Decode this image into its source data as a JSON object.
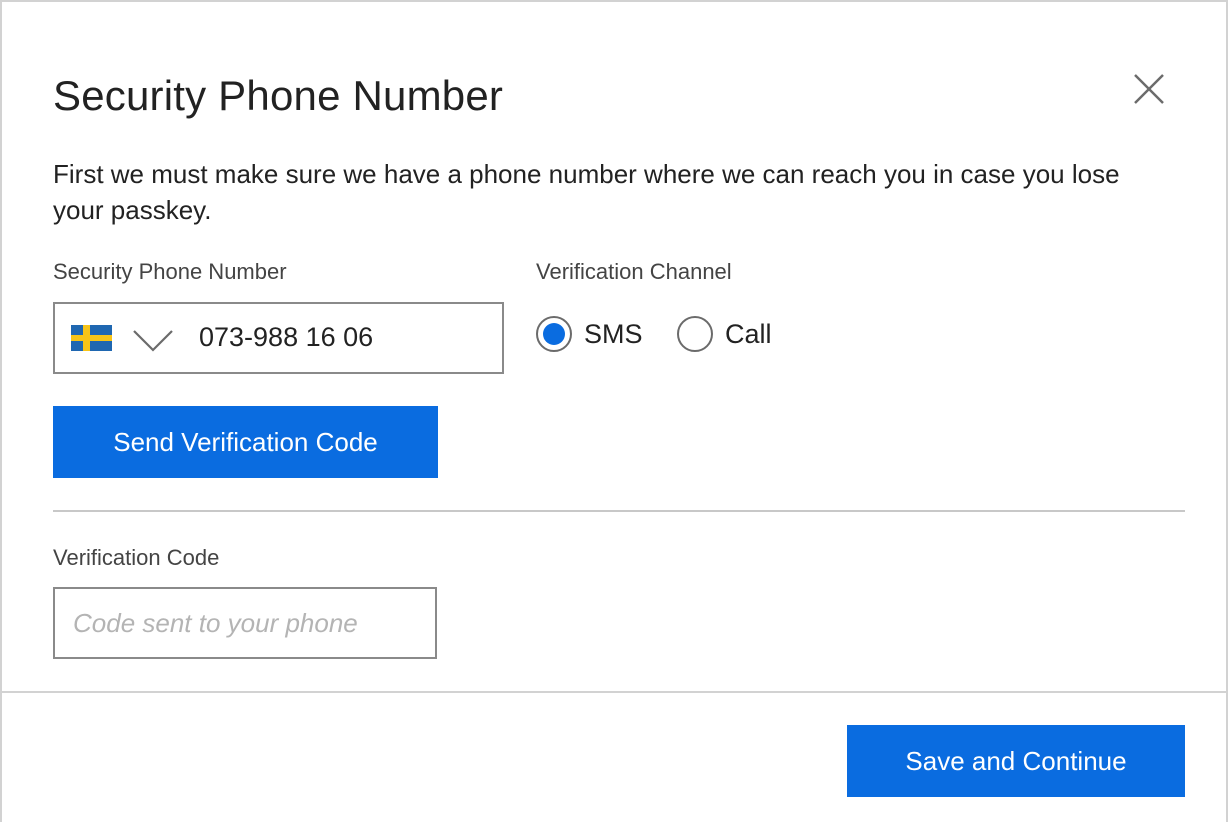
{
  "dialog": {
    "title": "Security Phone Number",
    "description": "First we must make sure we have a phone number where we can reach you in case you lose your passkey.",
    "close_icon": "close-icon"
  },
  "phone": {
    "label": "Security Phone Number",
    "country_flag": "sweden-flag-icon",
    "flag_colors": {
      "blue": "#1f67b1",
      "yellow": "#f7c418"
    },
    "value": "073-988 16 06"
  },
  "channel": {
    "label": "Verification Channel",
    "options": [
      {
        "label": "SMS",
        "selected": true
      },
      {
        "label": "Call",
        "selected": false
      }
    ]
  },
  "send_button": {
    "label": "Send Verification Code"
  },
  "code": {
    "label": "Verification Code",
    "placeholder": "Code sent to your phone",
    "value": ""
  },
  "footer": {
    "save_label": "Save and Continue"
  },
  "colors": {
    "accent": "#0a6ce0",
    "text": "#222222",
    "label": "#444444",
    "border": "#8a8a8a"
  }
}
